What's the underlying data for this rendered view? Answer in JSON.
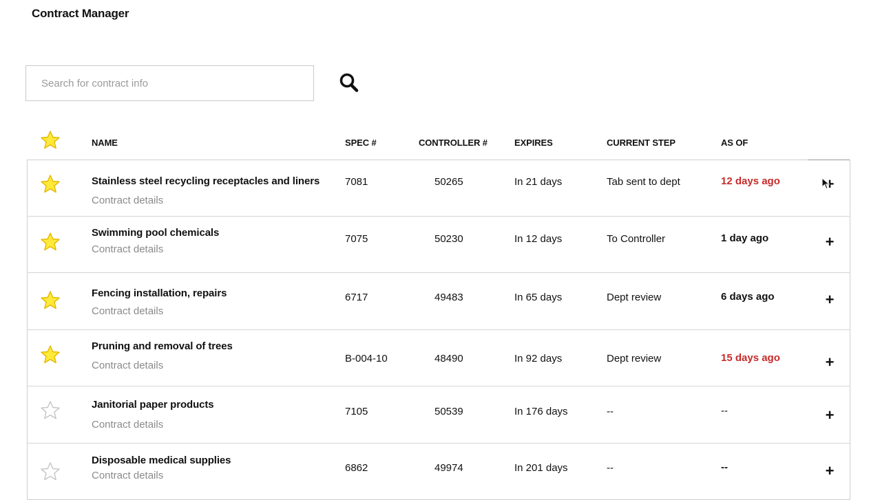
{
  "app": {
    "title": "Contract Manager"
  },
  "search": {
    "placeholder": "Search for contract info",
    "value": ""
  },
  "icons": {
    "search": "search-icon",
    "star_filled": "star-filled-icon",
    "star_empty": "star-empty-icon",
    "plus": "plus-icon"
  },
  "colors": {
    "late": "#c62b2b",
    "star_fill": "#ffe93b",
    "star_stroke": "#e3b800",
    "muted": "#8a8a8a"
  },
  "table": {
    "headers": {
      "name": "NAME",
      "spec": "SPEC #",
      "controller": "CONTROLLER #",
      "expires": "EXPIRES",
      "step": "CURRENT STEP",
      "asof": "AS OF"
    },
    "header_starred": true,
    "rows": [
      {
        "starred": true,
        "name": "Stainless steel recycling receptacles and liners",
        "details": "Contract details",
        "spec": "7081",
        "controller": "50265",
        "expires": "In 21 days",
        "step": "Tab sent to dept",
        "asof": "12 days ago",
        "asof_state": "late",
        "expand": "+"
      },
      {
        "starred": true,
        "name": "Swimming pool chemicals",
        "details": "Contract details",
        "spec": "7075",
        "controller": "50230",
        "expires": "In 12 days",
        "step": "To Controller",
        "asof": "1 day ago",
        "asof_state": "normal",
        "expand": "+"
      },
      {
        "starred": true,
        "name": "Fencing installation, repairs",
        "details": "Contract details",
        "spec": "6717",
        "controller": "49483",
        "expires": "In 65 days",
        "step": "Dept review",
        "asof": "6 days ago",
        "asof_state": "normal",
        "expand": "+"
      },
      {
        "starred": true,
        "name": "Pruning and removal of trees",
        "details": "Contract details",
        "spec": "B-004-10",
        "controller": "48490",
        "expires": "In 92 days",
        "step": "Dept review",
        "asof": "15 days ago",
        "asof_state": "late",
        "expand": "+"
      },
      {
        "starred": false,
        "name": "Janitorial paper products",
        "details": "Contract details",
        "spec": "7105",
        "controller": "50539",
        "expires": "In 176 days",
        "step": "--",
        "asof": "--",
        "asof_state": "plain",
        "expand": "+"
      },
      {
        "starred": false,
        "name": "Disposable medical supplies",
        "details": "Contract details",
        "spec": "6862",
        "controller": "49974",
        "expires": "In 201 days",
        "step": "--",
        "asof": "--",
        "asof_state": "normal",
        "expand": "+"
      }
    ]
  }
}
